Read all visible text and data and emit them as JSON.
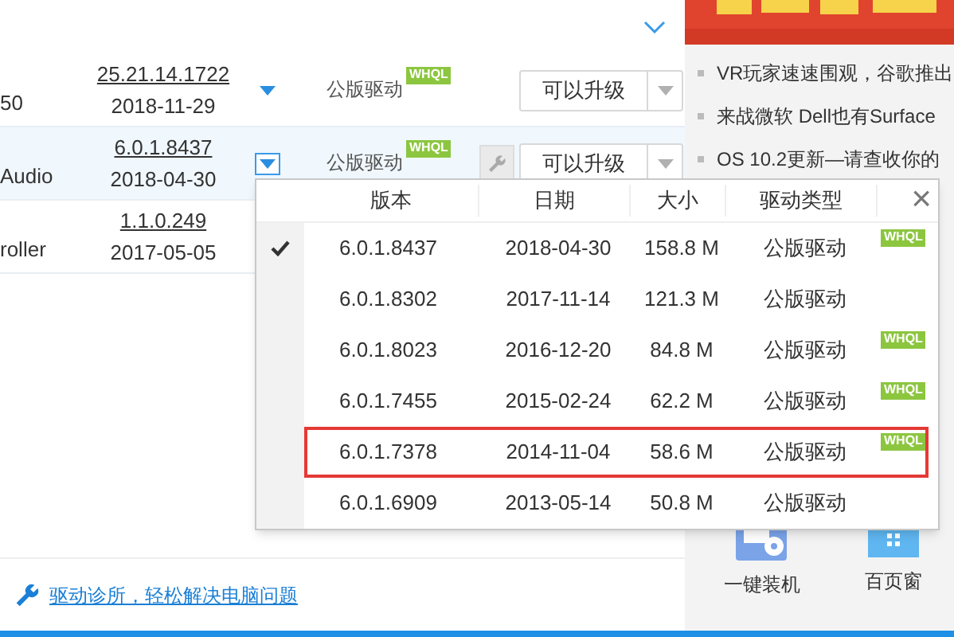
{
  "drivers": [
    {
      "name": "50",
      "version": "25.21.14.1722",
      "date": "2018-11-29",
      "highlighted": false,
      "expanded": false,
      "type": "公版驱动",
      "badge": "WHQL",
      "action": "可以升级"
    },
    {
      "name": "Audio",
      "version": "6.0.1.8437",
      "date": "2018-04-30",
      "highlighted": true,
      "expanded": true,
      "type": "公版驱动",
      "badge": "WHQL",
      "tool_button": true,
      "action": "可以升级"
    },
    {
      "name": "roller",
      "version": "1.1.0.249",
      "date": "2017-05-05",
      "highlighted": false
    }
  ],
  "version_popup": {
    "columns": [
      "版本",
      "日期",
      "大小",
      "驱动类型"
    ],
    "close": "×",
    "rows": [
      {
        "version": "6.0.1.8437",
        "date": "2018-04-30",
        "size": "158.8 M",
        "type": "公版驱动",
        "badge": "WHQL",
        "selected": true,
        "marked": false
      },
      {
        "version": "6.0.1.8302",
        "date": "2017-11-14",
        "size": "121.3 M",
        "type": "公版驱动",
        "selected": false,
        "marked": false
      },
      {
        "version": "6.0.1.8023",
        "date": "2016-12-20",
        "size": "84.8 M",
        "type": "公版驱动",
        "badge": "WHQL",
        "selected": false,
        "marked": false
      },
      {
        "version": "6.0.1.7455",
        "date": "2015-02-24",
        "size": "62.2 M",
        "type": "公版驱动",
        "badge": "WHQL",
        "selected": false,
        "marked": false
      },
      {
        "version": "6.0.1.7378",
        "date": "2014-11-04",
        "size": "58.6 M",
        "type": "公版驱动",
        "badge": "WHQL",
        "selected": false,
        "marked": true
      },
      {
        "version": "6.0.1.6909",
        "date": "2013-05-14",
        "size": "50.8 M",
        "type": "公版驱动",
        "selected": false,
        "marked": false
      }
    ]
  },
  "footer_link": "驱动诊所，轻松解决电脑问题",
  "news": [
    "VR玩家速速围观，谷歌推出",
    "来战微软 Dell也有Surface",
    "OS 10.2更新—请查收你的"
  ],
  "shortcuts": [
    {
      "kind": "install",
      "label": "一键装机"
    },
    {
      "kind": "window",
      "label": "百页窗"
    }
  ]
}
